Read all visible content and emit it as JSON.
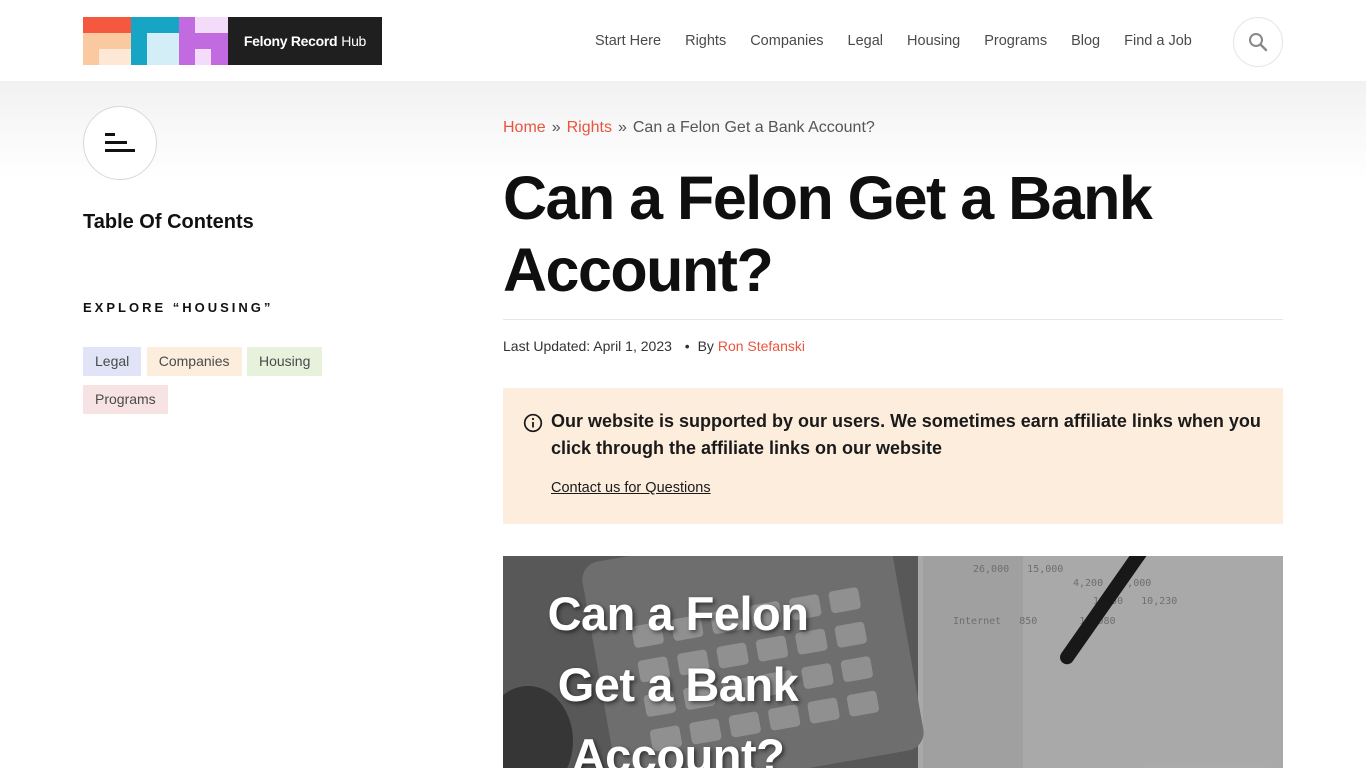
{
  "site": {
    "brand_bold": "Felony Record",
    "brand_light": "Hub"
  },
  "nav": {
    "items": [
      "Start Here",
      "Rights",
      "Companies",
      "Legal",
      "Housing",
      "Programs",
      "Blog",
      "Find a Job"
    ],
    "search_icon": "search-icon"
  },
  "sidebar": {
    "toc_icon": "menu-lines-icon",
    "toc_title": "Table Of Contents",
    "explore_label": "EXPLORE “HOUSING”",
    "tags": [
      {
        "label": "Legal",
        "color": "#e1e3f7"
      },
      {
        "label": "Companies",
        "color": "#fdeddd"
      },
      {
        "label": "Housing",
        "color": "#e6f2dc"
      },
      {
        "label": "Programs",
        "color": "#f7e3e3"
      }
    ]
  },
  "breadcrumb": {
    "home": "Home",
    "sep": "»",
    "section": "Rights",
    "current": "Can a Felon Get a Bank Account?"
  },
  "article": {
    "title": "Can a Felon Get a Bank Account?",
    "updated_label": "Last Updated: April 1, 2023",
    "by_label": "By",
    "author": "Ron Stefanski",
    "dot": "•"
  },
  "notice": {
    "icon": "info-icon",
    "text": "Our website is supported by our users. We sometimes earn affiliate links when you click through the affiliate links on our website",
    "link": "Contact us for Questions"
  },
  "hero": {
    "caption_lines": [
      "Can a Felon",
      "Get a Bank",
      "Account?"
    ]
  },
  "colors": {
    "accent": "#e8553f",
    "notice_bg": "#fdeddd",
    "logo_dark": "#1f1f1f"
  }
}
